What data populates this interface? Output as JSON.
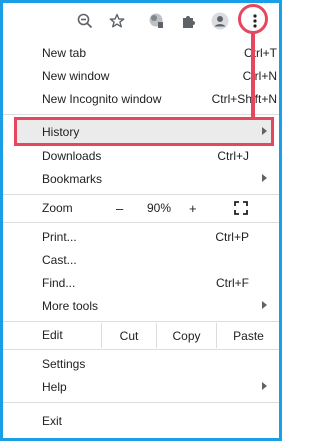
{
  "menu": {
    "new_tab": {
      "label": "New tab",
      "shortcut": "Ctrl+T"
    },
    "new_window": {
      "label": "New window",
      "shortcut": "Ctrl+N"
    },
    "new_incognito": {
      "label": "New Incognito window",
      "shortcut": "Ctrl+Shift+N"
    },
    "history": {
      "label": "History"
    },
    "downloads": {
      "label": "Downloads",
      "shortcut": "Ctrl+J"
    },
    "bookmarks": {
      "label": "Bookmarks"
    },
    "zoom": {
      "label": "Zoom",
      "minus": "–",
      "value": "90%",
      "plus": "+"
    },
    "print": {
      "label": "Print...",
      "shortcut": "Ctrl+P"
    },
    "cast": {
      "label": "Cast..."
    },
    "find": {
      "label": "Find...",
      "shortcut": "Ctrl+F"
    },
    "more_tools": {
      "label": "More tools"
    },
    "edit": {
      "label": "Edit",
      "cut": "Cut",
      "copy": "Copy",
      "paste": "Paste"
    },
    "settings": {
      "label": "Settings"
    },
    "help": {
      "label": "Help"
    },
    "exit": {
      "label": "Exit"
    }
  },
  "icons": {
    "zoom": "zoom-out-icon",
    "star": "star-icon",
    "ext1": "extension-puzzle-icon",
    "ext2": "puzzle-icon",
    "profile": "profile-icon",
    "menu": "three-dots-vertical-icon",
    "fullscreen": "fullscreen-icon"
  },
  "colors": {
    "highlight_border": "#e6475d",
    "frame_border": "#1a9ee5",
    "separator": "#dadce0"
  }
}
